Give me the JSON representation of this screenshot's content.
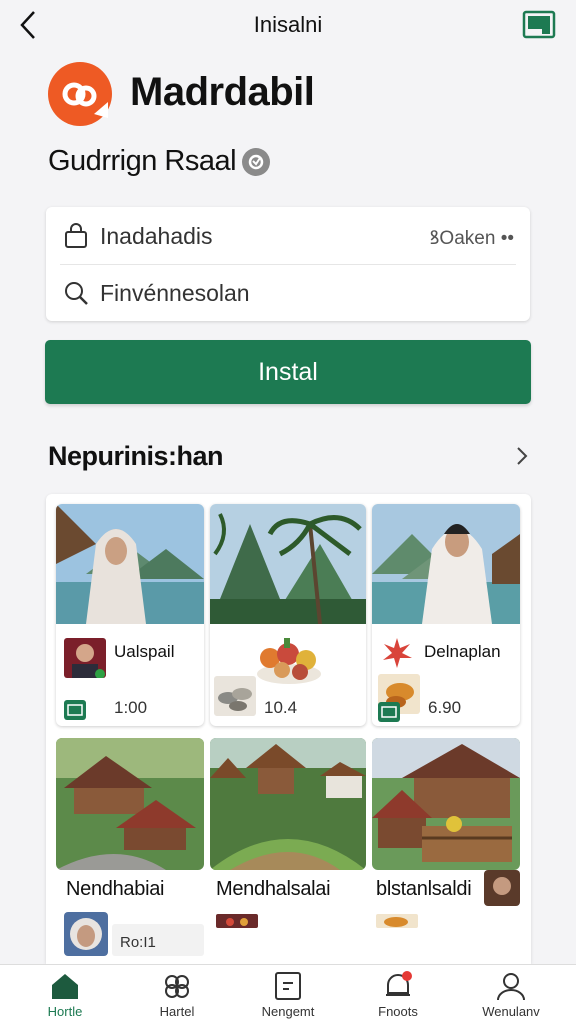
{
  "header": {
    "title": "Inisalni"
  },
  "app": {
    "name": "Madrdabil",
    "developer": "Gudrrign Rsaal"
  },
  "info": {
    "row1_text": "Inadahadis",
    "row1_right": "ꝸOaken ••",
    "row2_text": "Finvénnesolan"
  },
  "install_label": "Instal",
  "section": {
    "title": "Nepurinis:han"
  },
  "tiles": {
    "t1_label": "Ualspail",
    "t1_num": "1:00",
    "t2_num": "10.4",
    "t3_label": "Delnaplan",
    "t3_num": "6.90",
    "t4_label": "Nendhabiai",
    "t4_num": "Ro:I1",
    "t5_label": "Mendhalsalai",
    "t6_label": "blstanlsaldi"
  },
  "nav": {
    "items": [
      {
        "label": "Hortle"
      },
      {
        "label": "Hartel"
      },
      {
        "label": "Nengemt"
      },
      {
        "label": "Fnoots"
      },
      {
        "label": "Wenulanv"
      }
    ]
  },
  "colors": {
    "accent": "#1d7a52",
    "logo": "#ee5a24",
    "notification": "#e53935"
  }
}
